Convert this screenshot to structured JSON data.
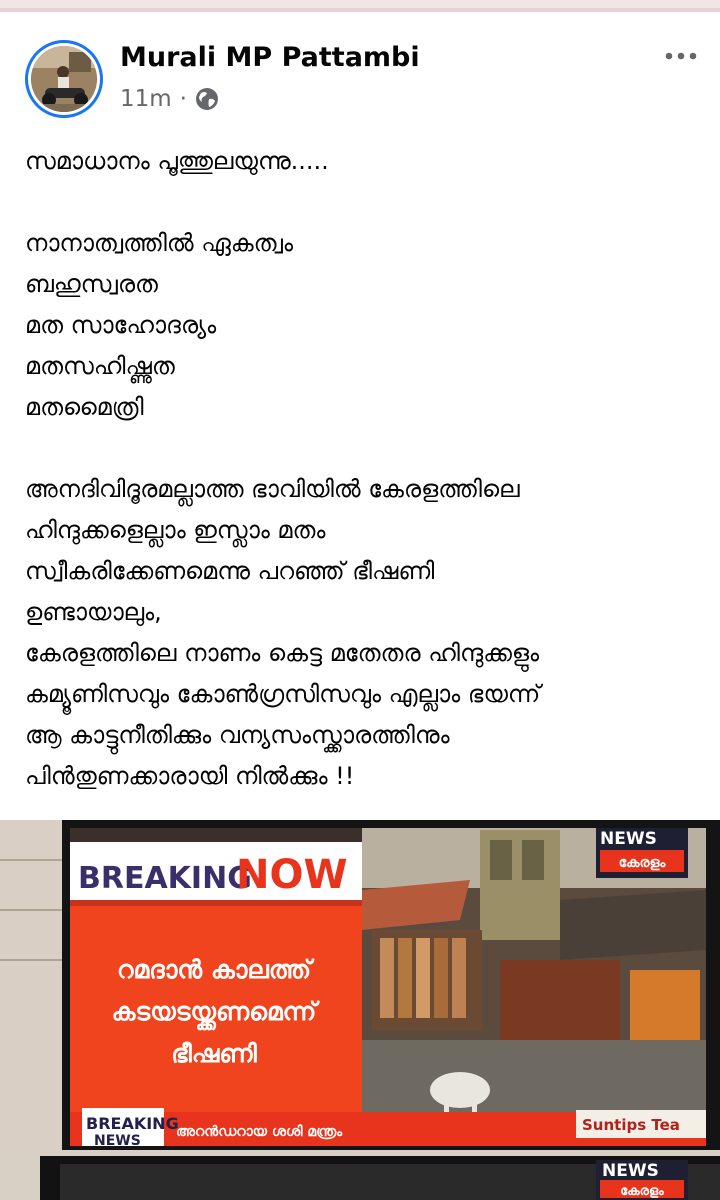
{
  "post": {
    "author": "Murali MP Pattambi",
    "time": "11m",
    "separator": "·",
    "lines": [
      "സമാധാനം പൂത്തുലയുന്നു.....",
      "",
      "നാനാത്വത്തിൽ ഏകത്വം",
      "ബഹുസ്വരത",
      "മത സാഹോദര്യം",
      "മതസഹിഷ്ണുത",
      "മതമൈത്രി",
      "",
      "അനദിവിദൂരമല്ലാത്ത ഭാവിയിൽ കേരളത്തിലെ",
      "ഹിന്ദുക്കളെല്ലാം ഇസ്ലാം മതം",
      "സ്വീകരിക്കേണമെന്നു പറഞ്ഞ് ഭീഷണി",
      "ഉണ്ടായാലും,",
      "കേരളത്തിലെ നാണം കെട്ട മതേതര ഹിന്ദുക്കളും",
      "കമ്യൂണിസവും കോൺഗ്രസിസവും എല്ലാം ഭയന്ന്",
      "ആ കാട്ടുനീതിക്കും വന്യസംസ്ക്കാരത്തിനും",
      "പിൻതുണക്കാരായി നിൽക്കും !!"
    ]
  },
  "icons": {
    "privacy": "globe-icon",
    "menu": "more-horizontal-icon"
  },
  "image": {
    "breaking": "BREAKING",
    "now": "NOW",
    "headline_1": "റമദാൻ കാലത്ത്",
    "headline_2": "കടയടയ്ക്കണമെന്ന്",
    "headline_3": "ഭീഷണി",
    "ticker_breaking": "BREAKING",
    "ticker_news": "NEWS",
    "ticker_text": "അറൻഡറായ ശശി മന്ത്രം",
    "channel_top": "NEWS",
    "channel_bottom": "കേരളം",
    "sponsor": "Suntips Tea",
    "channel2_top": "NEWS",
    "channel2_bottom": "കേരളം"
  },
  "colors": {
    "accent": "#1877f2",
    "breaking_red": "#f0441e",
    "secondary_text": "#65676b"
  }
}
